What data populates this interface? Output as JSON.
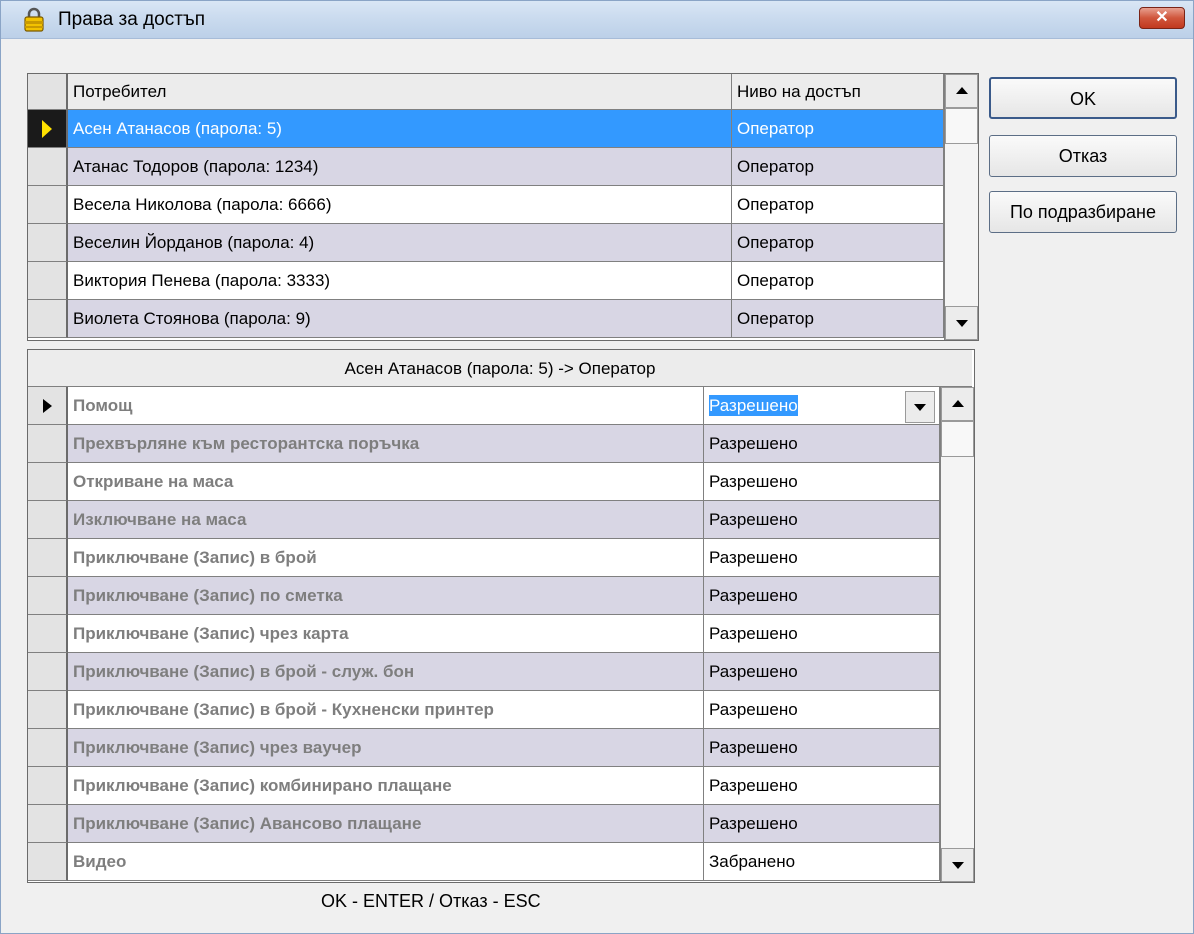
{
  "window": {
    "title": "Права за достъп",
    "close_label": "✕"
  },
  "users_grid": {
    "headers": {
      "user": "Потребител",
      "level": "Ниво на достъп"
    },
    "rows": [
      {
        "user": "Асен Атанасов (парола: 5)",
        "level": "Оператор"
      },
      {
        "user": "Атанас Тодоров (парола: 1234)",
        "level": "Оператор"
      },
      {
        "user": "Весела Николова (парола: 6666)",
        "level": "Оператор"
      },
      {
        "user": "Веселин Йорданов (парола: 4)",
        "level": "Оператор"
      },
      {
        "user": "Виктория Пенева (парола: 3333)",
        "level": "Оператор"
      },
      {
        "user": "Виолета Стоянова (парола: 9)",
        "level": "Оператор"
      }
    ]
  },
  "permissions_grid": {
    "title": "Асен Атанасов (парола: 5) -> Оператор",
    "rows": [
      {
        "name": "Помощ",
        "value": "Разрешено"
      },
      {
        "name": "Прехвърляне към ресторантска поръчка",
        "value": "Разрешено"
      },
      {
        "name": "Откриване на маса",
        "value": "Разрешено"
      },
      {
        "name": "Изключване на маса",
        "value": "Разрешено"
      },
      {
        "name": "Приключване (Запис) в брой",
        "value": "Разрешено"
      },
      {
        "name": "Приключване (Запис) по сметка",
        "value": "Разрешено"
      },
      {
        "name": "Приключване (Запис) чрез карта",
        "value": "Разрешено"
      },
      {
        "name": "Приключване (Запис) в брой - служ. бон",
        "value": "Разрешено"
      },
      {
        "name": "Приключване (Запис) в брой - Кухненски принтер",
        "value": "Разрешено"
      },
      {
        "name": "Приключване (Запис) чрез ваучер",
        "value": "Разрешено"
      },
      {
        "name": "Приключване (Запис) комбинирано плащане",
        "value": "Разрешено"
      },
      {
        "name": "Приключване (Запис) Авансово плащане",
        "value": "Разрешено"
      },
      {
        "name": "Видео",
        "value": "Забранено"
      }
    ]
  },
  "buttons": {
    "ok": "OK",
    "cancel": "Отказ",
    "default": "По подразбиране"
  },
  "footer": "OK - ENTER / Отказ - ESC",
  "colors": {
    "selection": "#3399ff",
    "alt_row": "#d8d6e4"
  }
}
